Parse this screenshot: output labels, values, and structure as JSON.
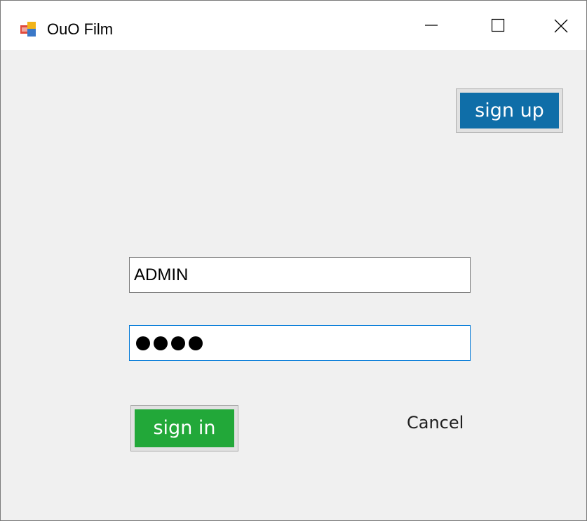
{
  "window": {
    "title": "OuO Film",
    "controls": {
      "minimize": "minimize-icon",
      "maximize": "maximize-icon",
      "close": "close-icon"
    }
  },
  "header": {
    "signup_label": "sign up"
  },
  "form": {
    "username_value": "ADMIN",
    "password_masked_count": 4,
    "signin_label": "sign in",
    "cancel_label": "Cancel"
  },
  "colors": {
    "signup_bg": "#0f6ea8",
    "signin_bg": "#22a839",
    "focus_border": "#0078d7",
    "client_bg": "#f0f0f0"
  }
}
